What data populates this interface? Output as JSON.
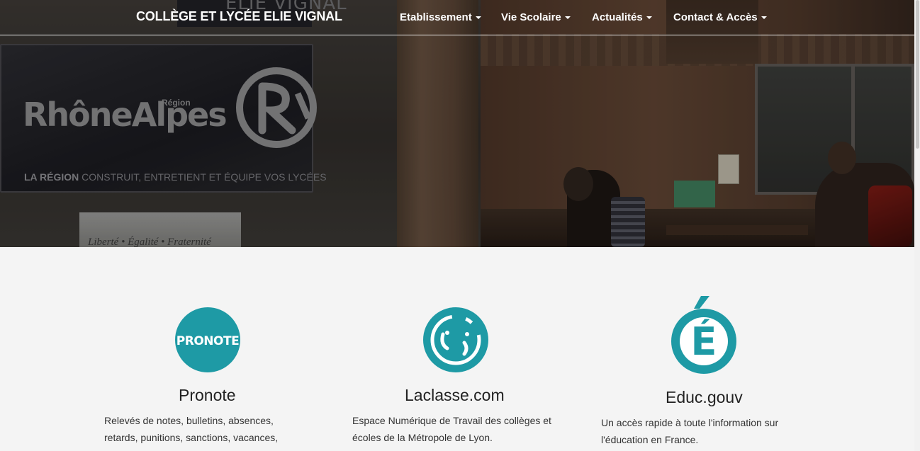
{
  "navbar": {
    "brand": "COLLÈGE ET LYCÉE ELIE VIGNAL",
    "items": [
      {
        "label": "Etablissement"
      },
      {
        "label": "Vie Scolaire"
      },
      {
        "label": "Actualités"
      },
      {
        "label": "Contact & Accès"
      }
    ]
  },
  "hero": {
    "plaque_top_text": "ELIE VIGNAL",
    "logo_word": "RhôneAlpes",
    "logo_region": "Région",
    "plaque_line_bold": "LA RÉGION",
    "plaque_line": "CONSTRUIT, ENTRETIENT ET ÉQUIPE VOS LYCÉES",
    "marble_text": "Liberté • Égalité • Fraternité"
  },
  "services": [
    {
      "icon": "pronote-icon",
      "icon_text": "PRONOTE",
      "title": "Pronote",
      "description": "Relevés de notes, bulletins, absences, retards, punitions, sanctions, vacances,"
    },
    {
      "icon": "laclasse-icon",
      "title": "Laclasse.com",
      "description": "Espace Numérique de Travail des collèges et écoles de la Métropole de Lyon."
    },
    {
      "icon": "education-icon",
      "icon_text": "É",
      "title": "Educ.gouv",
      "description": "Un accès rapide à toute l'information sur l'éducation en France."
    }
  ],
  "colors": {
    "accent": "#1e9aa5",
    "page_bg": "#f4f4f4",
    "text": "#222222"
  }
}
